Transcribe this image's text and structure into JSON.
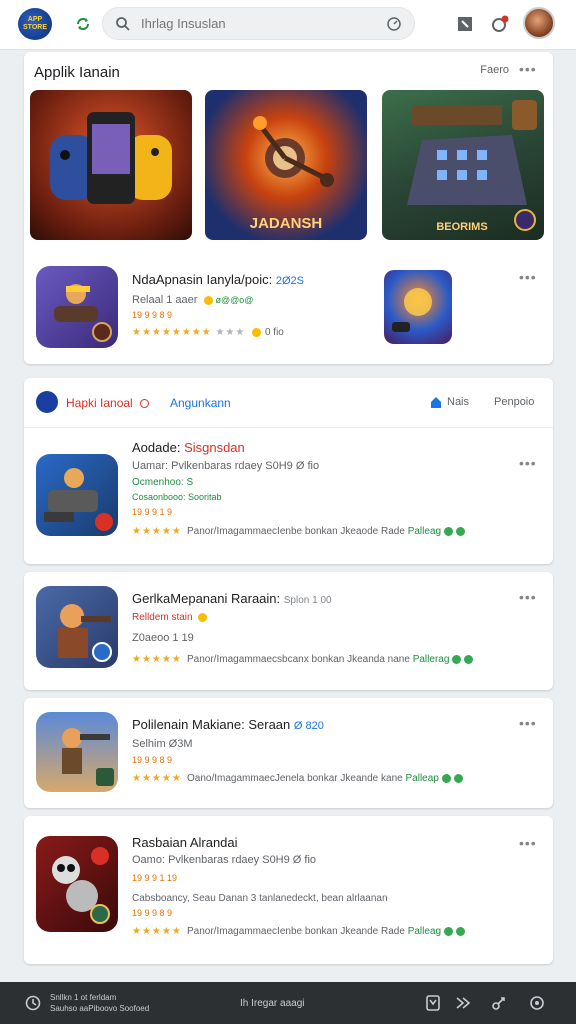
{
  "app": {
    "logo_text": "APP STORE"
  },
  "search": {
    "placeholder": "Ihrlag Insuslan"
  },
  "featured": {
    "title": "Applik Ianain",
    "more_label": "Faero",
    "banners": [
      {
        "name": "controller-phone-banner"
      },
      {
        "name": "spinner-banner",
        "caption": "JADANSH"
      },
      {
        "name": "board-game-banner",
        "caption": "BEORIMS"
      }
    ],
    "top_app": {
      "title": "NdaApnasin Ianyla/poic:",
      "year": "2Ø2S",
      "subtitle": "Relaal 1 aaer",
      "badge": "ø@@o@",
      "tag": "19 9 9 8 9",
      "rating_stars": "★★★★★★★★",
      "rating_grey": "★★★",
      "rating_count": "0 fio"
    }
  },
  "list_header": {
    "label_red": "Hapki Ianoal",
    "label_blue": "Angunkann",
    "link_home": "Nais",
    "link_right": "Penpoio"
  },
  "apps": [
    {
      "title": "Aodade:",
      "title_accent": "Sisgnsdan",
      "line1": "Uamar: Pvlkenbaras rdaey  S0H9 Ø fio",
      "line2": "Ocmenhoo: S",
      "line3": "Cosaonbooo:  Sooritab",
      "line4": "19 9 9 1 9",
      "desc": "Panor/ImagammaecIenbe bonkan Jkeaode Rade",
      "link": "Palleag"
    },
    {
      "title": "GerlkaMepanani Raraain:",
      "title_suffix": "Splon 1 00",
      "line1": "Relldem stain",
      "line2": "Z0aeoo 1 19",
      "desc": "Panor/Imagammaecsbcanx bonkan Jkeanda nane",
      "link": "Pallerag"
    },
    {
      "title": "Polilenain Makiane: Seraan",
      "title_suffix": "Ø 820",
      "line1": "Selhim  Ø3M",
      "line2": "19 9 9 8 9",
      "desc": "Oano/ImagammaecJenela bonkar Jkeande kane",
      "link": "Palleap"
    },
    {
      "title": "Rasbaian Alrandai",
      "line1": "Oamo: Pvlkenbaras rdaey  S0H9 Ø fio",
      "line2": "19 9 9 1 19",
      "line3": "Cabsboancy,  Seau Danan 3 tanlanedeckt, bean alrlaanan",
      "line4": "19 9 9 8 9",
      "desc": "Panor/ImagammaecIenbe bonkan Jkeande Rade",
      "link": "Palleag"
    }
  ],
  "bottombar": {
    "left_line1": "Snllkn 1 ot ferldam",
    "left_line2": "Sauhso aaPiboovo Soofoed",
    "center": "Ih Iregar aaagi"
  },
  "colors": {
    "accent_green": "#1e8e3e",
    "accent_red": "#d93025",
    "accent_blue": "#1a73e8",
    "star": "#f5a623"
  }
}
